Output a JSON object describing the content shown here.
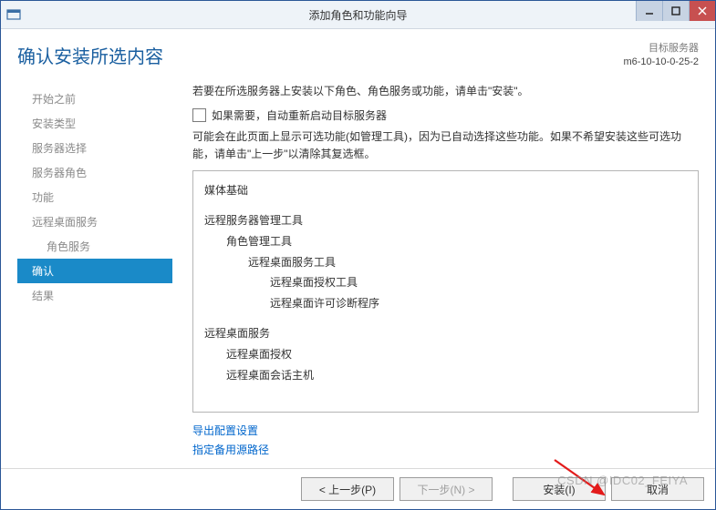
{
  "window": {
    "title": "添加角色和功能向导"
  },
  "header": {
    "page_title": "确认安装所选内容",
    "target_label": "目标服务器",
    "target_name": "m6-10-10-0-25-2"
  },
  "sidebar": {
    "items": [
      {
        "label": "开始之前",
        "indent": false,
        "active": false
      },
      {
        "label": "安装类型",
        "indent": false,
        "active": false
      },
      {
        "label": "服务器选择",
        "indent": false,
        "active": false
      },
      {
        "label": "服务器角色",
        "indent": false,
        "active": false
      },
      {
        "label": "功能",
        "indent": false,
        "active": false
      },
      {
        "label": "远程桌面服务",
        "indent": false,
        "active": false
      },
      {
        "label": "角色服务",
        "indent": true,
        "active": false
      },
      {
        "label": "确认",
        "indent": false,
        "active": true
      },
      {
        "label": "结果",
        "indent": false,
        "active": false
      }
    ]
  },
  "content": {
    "intro": "若要在所选服务器上安装以下角色、角色服务或功能，请单击\"安装\"。",
    "checkbox_label": "如果需要，自动重新启动目标服务器",
    "note": "可能会在此页面上显示可选功能(如管理工具)，因为已自动选择这些功能。如果不希望安装这些可选功能，请单击\"上一步\"以清除其复选框。",
    "items": [
      {
        "text": "媒体基础",
        "level": 0
      },
      {
        "text": "远程服务器管理工具",
        "level": 0
      },
      {
        "text": "角色管理工具",
        "level": 1
      },
      {
        "text": "远程桌面服务工具",
        "level": 2
      },
      {
        "text": "远程桌面授权工具",
        "level": 3
      },
      {
        "text": "远程桌面许可诊断程序",
        "level": 3
      },
      {
        "text": "远程桌面服务",
        "level": 0
      },
      {
        "text": "远程桌面授权",
        "level": 1
      },
      {
        "text": "远程桌面会话主机",
        "level": 1
      }
    ],
    "link_export": "导出配置设置",
    "link_altsrc": "指定备用源路径"
  },
  "footer": {
    "prev": "< 上一步(P)",
    "next": "下一步(N) >",
    "install": "安装(I)",
    "cancel": "取消"
  },
  "watermark": "CSDN @IDC02_FEIYA"
}
